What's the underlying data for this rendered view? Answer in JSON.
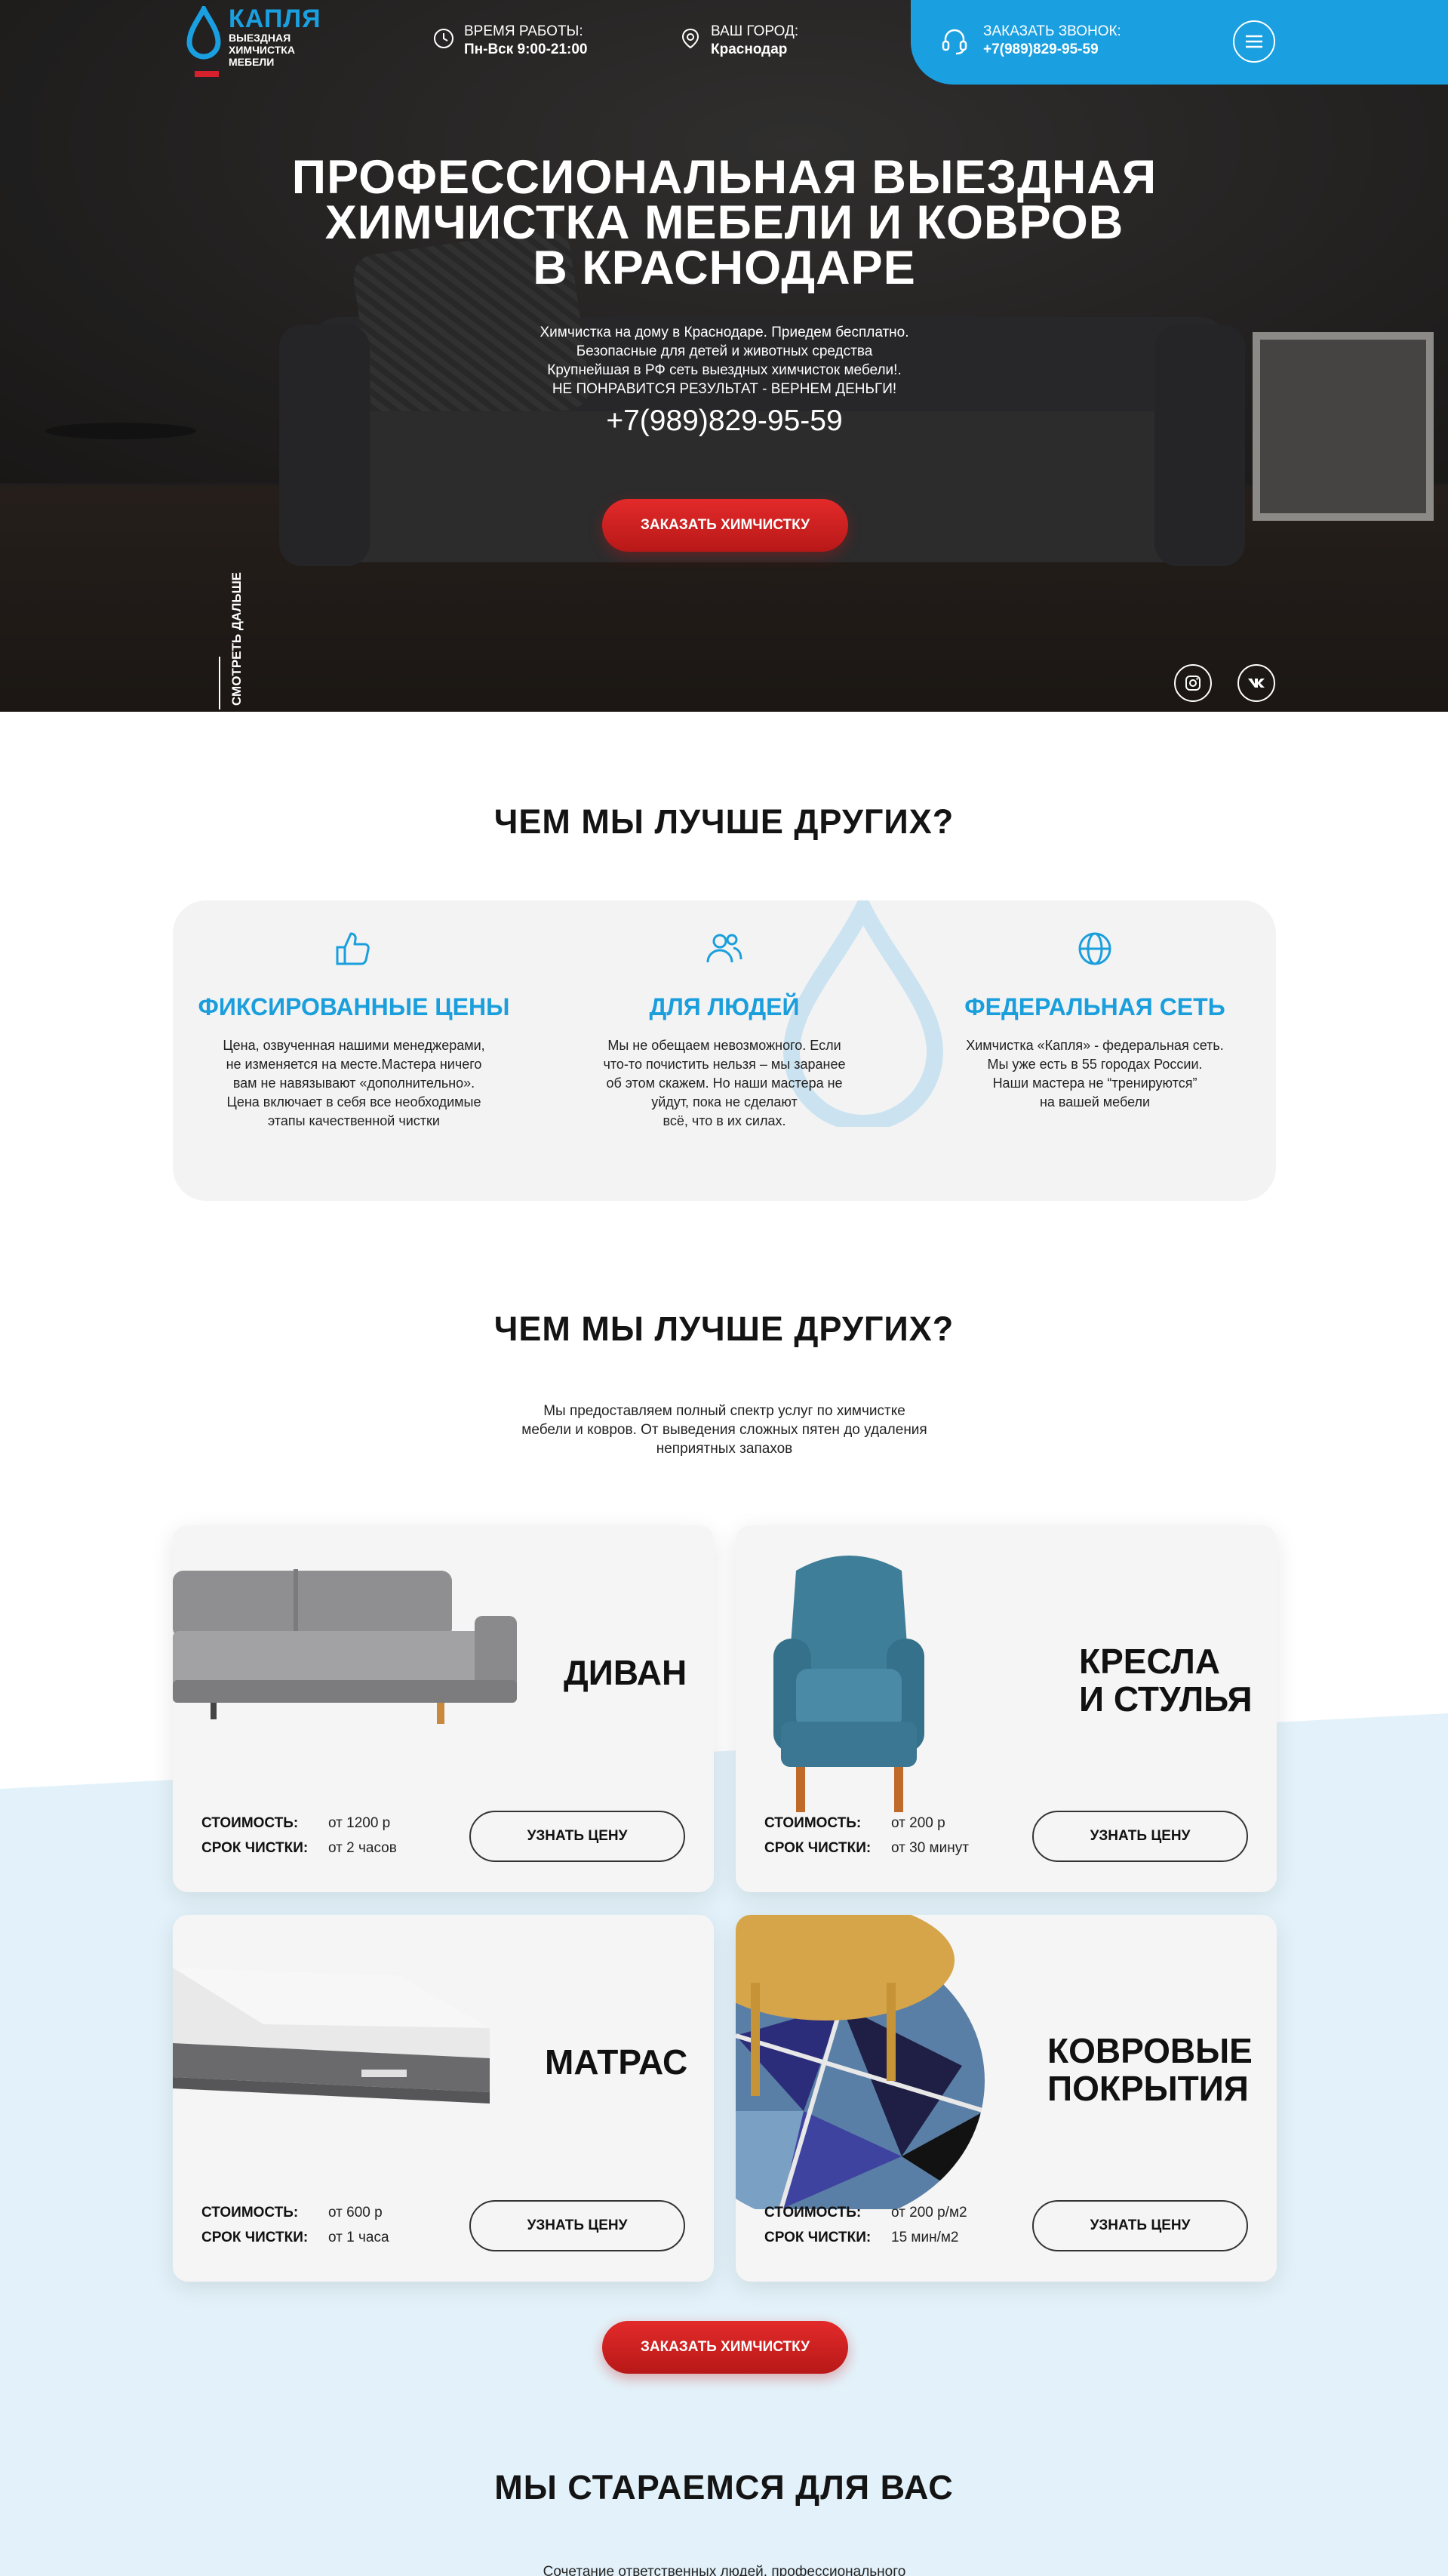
{
  "header": {
    "logo_brand": "КАПЛЯ",
    "logo_sub": "ВЫЕЗДНАЯ ХИМЧИСТКА МЕБЕЛИ",
    "hours_label": "ВРЕМЯ РАБОТЫ:",
    "hours_value": "Пн-Вск 9:00-21:00",
    "city_label": "ВАШ ГОРОД:",
    "city_value": "Краснодар",
    "call_label": "ЗАКАЗАТЬ ЗВОНОК:",
    "call_value": "+7(989)829-95-59"
  },
  "hero": {
    "title_lines": [
      "ПРОФЕССИОНАЛЬНАЯ ВЫЕЗДНАЯ",
      "ХИМЧИСТКА МЕБЕЛИ И КОВРОВ",
      "В КРАСНОДАРЕ"
    ],
    "lines": [
      "Химчистка на дому в Краснодаре. Приедем бесплатно.",
      "Безопасные для детей и животных средства",
      "Крупнейшая в РФ сеть выездных химчисток мебели!.",
      "НЕ ПОНРАВИТСЯ РЕЗУЛЬТАТ - ВЕРНЕМ ДЕНЬГИ!"
    ],
    "phone": "+7(989)829-95-59",
    "order_button": "ЗАКАЗАТЬ ХИМЧИСТКУ",
    "scroll_label": "СМОТРЕТЬ ДАЛЬШЕ",
    "social_instagram": "instagram-icon",
    "social_vk": "vk-icon"
  },
  "advantages": {
    "title": "ЧЕМ МЫ ЛУЧШЕ ДРУГИХ?",
    "items": [
      {
        "icon": "thumbs-up-icon",
        "title": "ФИКСИРОВАННЫЕ ЦЕНЫ",
        "text_lines": [
          "Цена, озвученная нашими менеджерами,",
          "не изменяется на месте.Мастера ничего",
          "вам не навязывают «дополнительно».",
          "Цена включает в себя все необходимые",
          "этапы качественной чистки"
        ]
      },
      {
        "icon": "people-icon",
        "title": "ДЛЯ ЛЮДЕЙ",
        "text_lines": [
          "Мы не обещаем невозможного. Если",
          "что-то почистить нельзя – мы заранее",
          "об этом скажем. Но наши мастера не",
          "уйдут, пока не сделают",
          "всё, что в их силах."
        ]
      },
      {
        "icon": "globe-icon",
        "title": "ФЕДЕРАЛЬНАЯ СЕТЬ",
        "text_lines": [
          "Химчистка «Капля» - федеральная сеть.",
          "Мы уже есть в 55 городах России.",
          "Наши мастера не “тренируются”",
          "на вашей мебели"
        ]
      }
    ]
  },
  "services": {
    "title": "ЧЕМ МЫ ЛУЧШЕ ДРУГИХ?",
    "subtitle_lines": [
      "Мы предоставляем полный спектр услуг по химчистке",
      "мебели и ковров. От выведения сложных пятен до удаления",
      "неприятных запахов"
    ],
    "cost_label": "СТОИМОСТЬ:",
    "time_label": "СРОК ЧИСТКИ:",
    "price_button": "УЗНАТЬ ЦЕНУ",
    "cards": [
      {
        "title_lines": [
          "ДИВАН"
        ],
        "cost": "от 1200 р",
        "time": "от 2 часов"
      },
      {
        "title_lines": [
          "КРЕСЛА",
          "И СТУЛЬЯ"
        ],
        "cost": "от 200 р",
        "time": "от 30 минут"
      },
      {
        "title_lines": [
          "МАТРАС"
        ],
        "cost": "от 600 р",
        "time": "от 1 часа"
      },
      {
        "title_lines": [
          "КОВРОВЫЕ",
          "ПОКРЫТИЯ"
        ],
        "cost": "от 200 р/м2",
        "time": "15 мин/м2"
      }
    ],
    "order_button": "ЗАКАЗАТЬ ХИМЧИСТКУ"
  },
  "care": {
    "title": "МЫ СТАРАЕМСЯ ДЛЯ ВАС",
    "subtitle_line": "Сочетание ответственных людей, профессионального"
  },
  "colors": {
    "accent_blue": "#1aa0e0",
    "accent_red": "#d6202b",
    "band_blue": "#e3f2fa"
  }
}
